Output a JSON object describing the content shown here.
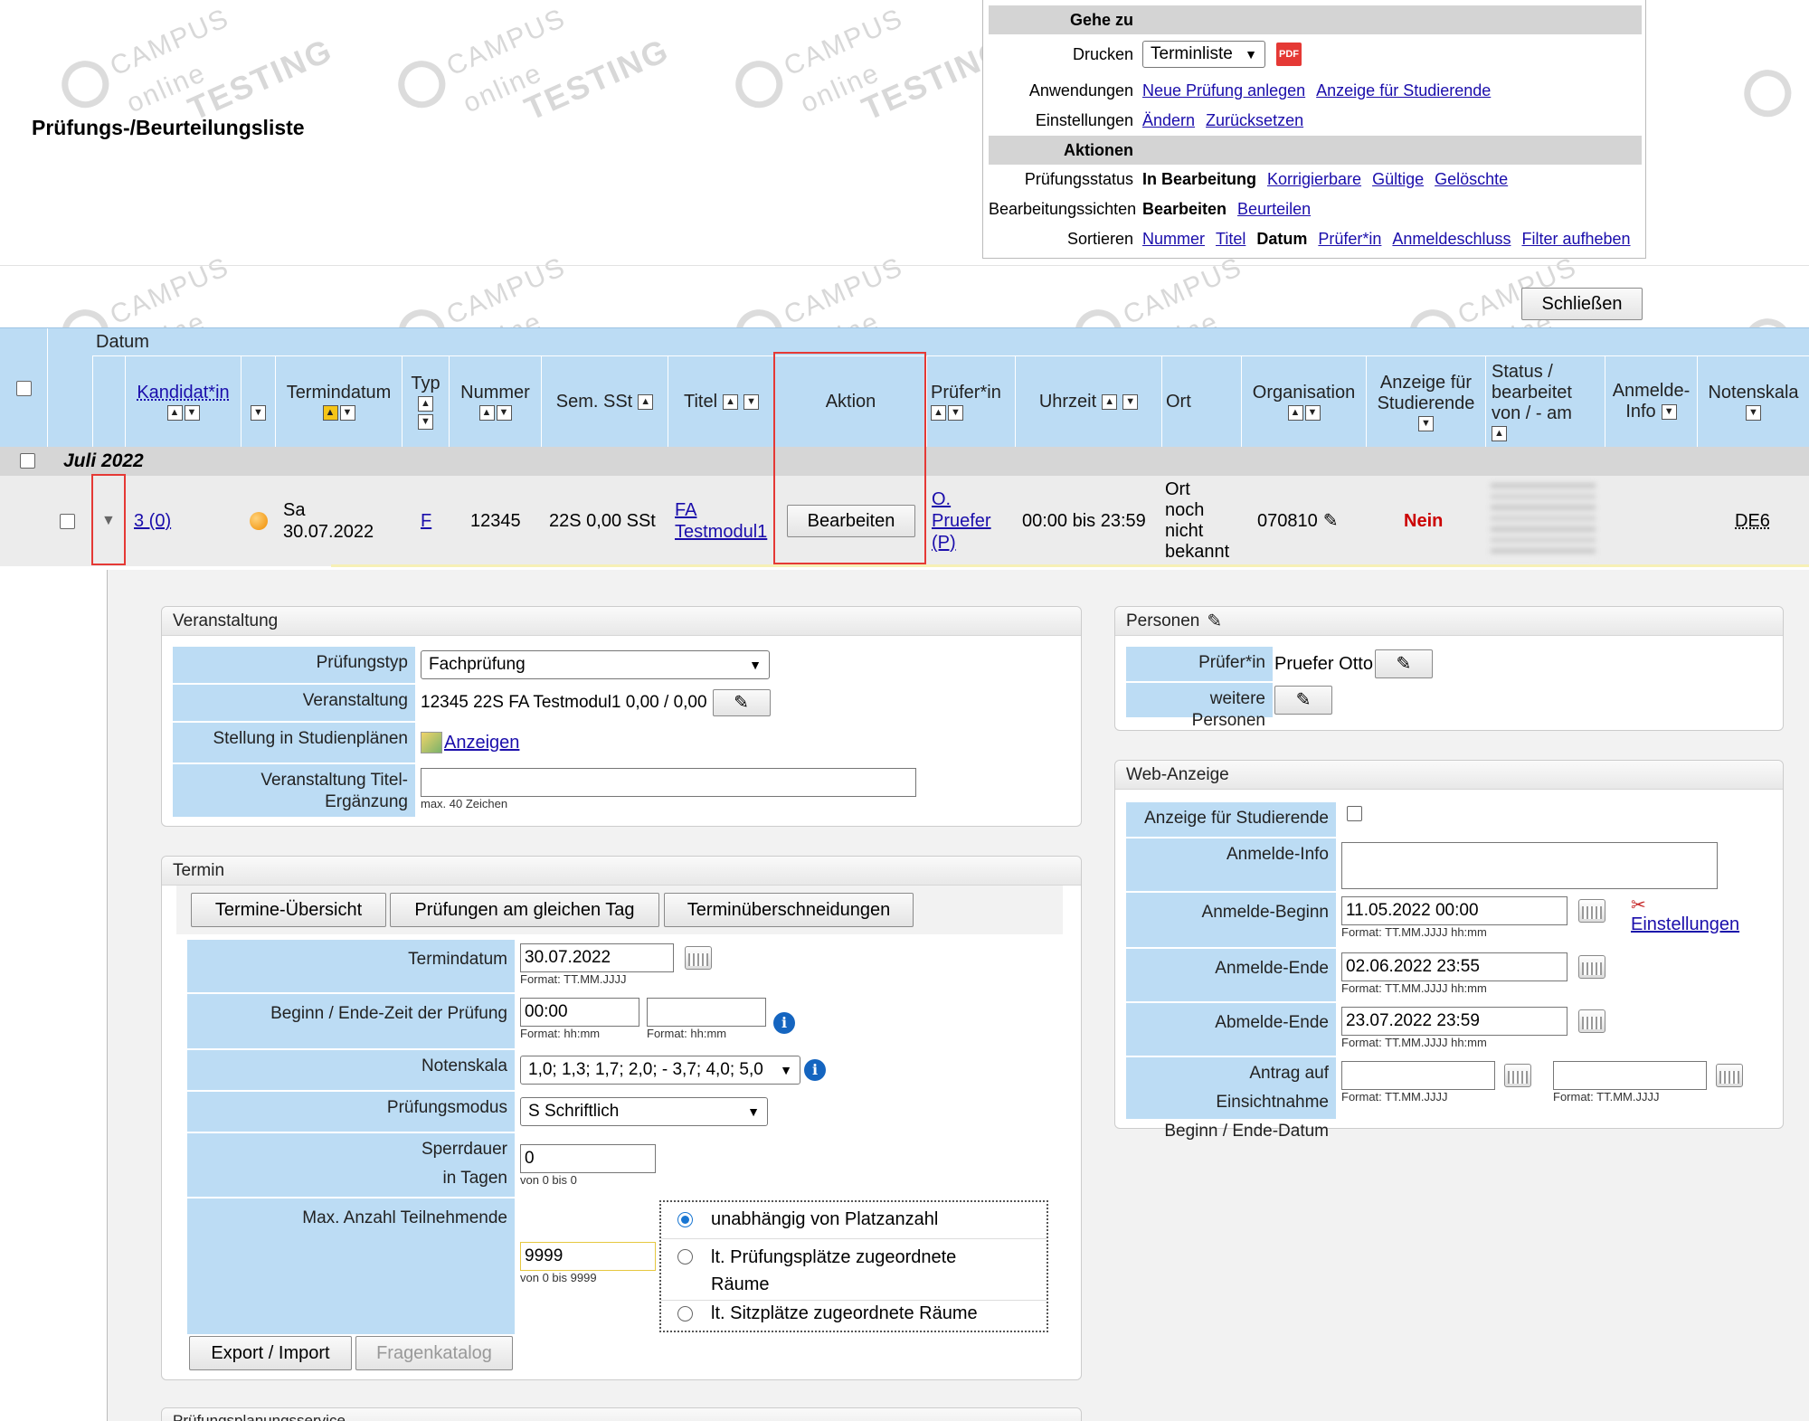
{
  "page": {
    "title": "Prüfungs-/Beurteilungsliste"
  },
  "watermark": {
    "line1": "CAMPUS",
    "line2": "online",
    "line3": "TESTING"
  },
  "top_panel": {
    "goto_label": "Gehe zu",
    "print_label": "Drucken",
    "print_select": "Terminliste",
    "pdf_badge": "PDF",
    "apps_label": "Anwendungen",
    "apps_links": [
      "Neue Prüfung anlegen",
      "Anzeige für Studierende"
    ],
    "settings_label": "Einstellungen",
    "settings_links": [
      "Ändern",
      "Zurücksetzen"
    ],
    "actions_label": "Aktionen",
    "status_label": "Prüfungsstatus",
    "status_current": "In Bearbeitung",
    "status_links": [
      "Korrigierbare",
      "Gültige",
      "Gelöschte"
    ],
    "views_label": "Bearbeitungssichten",
    "views_current": "Bearbeiten",
    "views_links": [
      "Beurteilen"
    ],
    "sort_label": "Sortieren",
    "sort_links": [
      "Nummer",
      "Titel"
    ],
    "sort_current": "Datum",
    "sort_links2": [
      "Prüfer*in",
      "Anmeldeschluss",
      "Filter aufheben"
    ],
    "close_button": "Schließen"
  },
  "table": {
    "group_header": "Datum",
    "headers": {
      "kandidat": "Kandidat*in",
      "termindatum": "Termindatum",
      "typ": "Typ",
      "nummer": "Nummer",
      "sem": "Sem. SSt",
      "titel": "Titel",
      "aktion": "Aktion",
      "pruefer": "Prüfer*in",
      "uhrzeit": "Uhrzeit",
      "ort": "Ort",
      "organisation": "Organisation",
      "anzeige1": "Anzeige für",
      "anzeige2": "Studierende",
      "status1": "Status /",
      "status2": "bearbeitet",
      "status3": "von / - am",
      "anmelde1": "Anmelde-",
      "anmelde2": "Info",
      "notenskala": "Notenskala"
    },
    "group_row": "Juli 2022",
    "row": {
      "kandidat": "3 (0)",
      "day": "Sa",
      "date": "30.07.2022",
      "typ": "F",
      "nummer": "12345",
      "sem": "22S 0,00 SSt",
      "titel1": "FA",
      "titel2": "Testmodul1",
      "action_button": "Bearbeiten",
      "pruefer1": "O.",
      "pruefer2": "Pruefer",
      "pruefer3": "(P)",
      "uhrzeit": "00:00 bis 23:59",
      "ort1": "Ort",
      "ort2": "noch",
      "ort3": "nicht",
      "ort4": "bekannt",
      "organisation": "070810",
      "anzeige": "Nein",
      "notenskala": "DE6"
    }
  },
  "veranstaltung": {
    "header": "Veranstaltung",
    "pruefungstyp_label": "Prüfungstyp",
    "pruefungstyp_value": "Fachprüfung",
    "veranstaltung_label": "Veranstaltung",
    "veranstaltung_value": "12345 22S FA Testmodul1 0,00 / 0,00",
    "stellung_label": "Stellung in Studienplänen",
    "stellung_link": "Anzeigen",
    "titel_label": "Veranstaltung Titel-Ergänzung",
    "titel_hint": "max. 40 Zeichen"
  },
  "termin": {
    "header": "Termin",
    "buttons": [
      "Termine-Übersicht",
      "Prüfungen am gleichen Tag",
      "Terminüberschneidungen"
    ],
    "termindatum_label": "Termindatum",
    "termindatum_value": "30.07.2022",
    "termindatum_fmt": "Format: TT.MM.JJJJ",
    "zeit_label": "Beginn / Ende-Zeit der Prüfung",
    "zeit_begin": "00:00",
    "zeit_fmt": "Format: hh:mm",
    "notenskala_label": "Notenskala",
    "notenskala_value": "1,0; 1,3; 1,7; 2,0; - 3,7; 4,0; 5,0",
    "modus_label": "Prüfungsmodus",
    "modus_value": "S Schriftlich",
    "sperr_label1": "Sperrdauer",
    "sperr_label2": "in Tagen",
    "sperr_value": "0",
    "sperr_hint": "von 0 bis 0",
    "max_label": "Max. Anzahl Teilnehmende",
    "max_value": "9999",
    "max_hint": "von 0 bis 9999",
    "radio1": "unabhängig von Platzanzahl",
    "radio2a": "lt. Prüfungsplätze zugeordnete",
    "radio2b": "Räume",
    "radio3": "lt. Sitzplätze zugeordnete Räume",
    "export_button": "Export / Import",
    "fragen_button": "Fragenkatalog"
  },
  "next_box_header": "Prüfungsplanungsservice",
  "personen": {
    "header": "Personen",
    "pruefer_label": "Prüfer*in",
    "pruefer_value": "Pruefer Otto",
    "weitere_label": "weitere Personen"
  },
  "web": {
    "header": "Web-Anzeige",
    "anzeige_label": "Anzeige für Studierende",
    "info_label": "Anmelde-Info",
    "beginn_label": "Anmelde-Beginn",
    "beginn_value": "11.05.2022 00:00",
    "dt_fmt": "Format: TT.MM.JJJJ hh:mm",
    "einstellungen_link": "Einstellungen",
    "ende_label": "Anmelde-Ende",
    "ende_value": "02.06.2022 23:55",
    "abmelde_label": "Abmelde-Ende",
    "abmelde_value": "23.07.2022 23:59",
    "antrag_label1": "Antrag auf Einsichtnahme",
    "antrag_label2": "Beginn / Ende-Datum",
    "d_fmt": "Format: TT.MM.JJJJ"
  },
  "colors": {
    "header_blue": "#bcdcf4",
    "highlight_red": "#e53935",
    "nein_red": "#cc0000",
    "link_blue": "#1a0dab"
  }
}
